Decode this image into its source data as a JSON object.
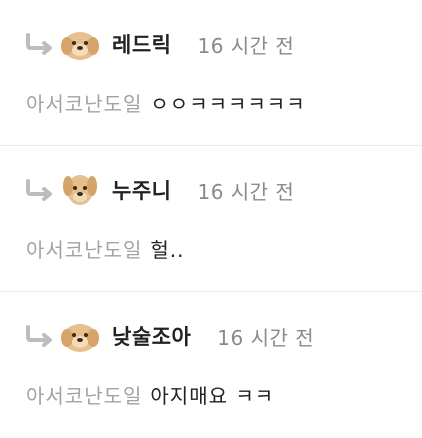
{
  "colors": {
    "nickname": "#222222",
    "time": "#8a8a8a",
    "mention": "#a3a3a3",
    "text": "#222222",
    "divider": "#ececec",
    "reply_arrow": "#bdbdbd"
  },
  "replies": [
    {
      "nickname": "레드릭",
      "time": "16 시간 전",
      "mention": "아서코난도일",
      "text": "ㅇㅇㅋㅋㅋㅋㅋㅋ",
      "avatar_icon": "puppy-avatar-icon"
    },
    {
      "nickname": "누주니",
      "time": "16 시간 전",
      "mention": "아서코난도일",
      "text": "헐..",
      "avatar_icon": "puppy-avatar-icon"
    },
    {
      "nickname": "낮술조아",
      "time": "16 시간 전",
      "mention": "아서코난도일",
      "text": "아지매요 ㅋㅋ",
      "avatar_icon": "puppy-avatar-icon"
    }
  ]
}
